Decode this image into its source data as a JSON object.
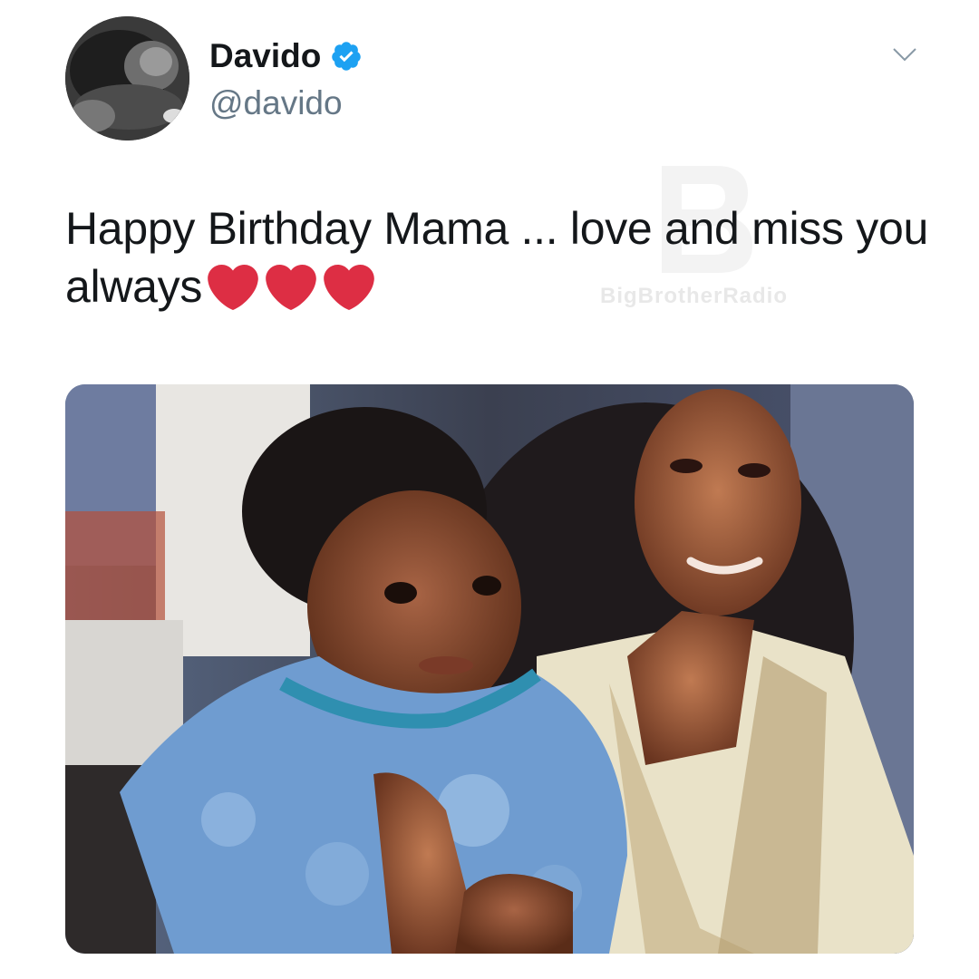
{
  "author": {
    "display_name": "Davido",
    "handle": "@davido",
    "verified": true
  },
  "tweet": {
    "text": "Happy Birthday Mama ... love and miss you always",
    "emoji": [
      "heart-emoji",
      "heart-emoji",
      "heart-emoji"
    ]
  },
  "watermark": {
    "text": "BigBrotherRadio"
  },
  "icons": {
    "verified": "verified-badge-icon",
    "menu": "chevron-down-icon"
  },
  "colors": {
    "verified_blue": "#1da1f2",
    "handle_gray": "#657786",
    "text": "#14171a",
    "heart_red": "#dd2e44"
  }
}
